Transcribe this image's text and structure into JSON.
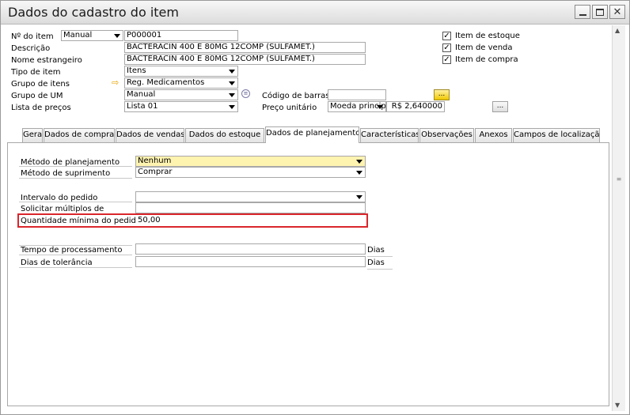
{
  "window": {
    "title": "Dados do cadastro do item"
  },
  "header": {
    "item_no_label": "Nº do item",
    "item_no_series": "Manual",
    "item_no_value": "P000001",
    "description_label": "Descrição",
    "description_value": "BACTERACIN 400 E 80MG 12COMP (SULFAMET.)",
    "foreign_name_label": "Nome estrangeiro",
    "foreign_name_value": "BACTERACIN 400 E 80MG 12COMP (SULFAMET.)",
    "item_type_label": "Tipo de item",
    "item_type_value": "Itens",
    "item_group_label": "Grupo de itens",
    "item_group_value": "Reg. Medicamentos",
    "uom_group_label": "Grupo de UM",
    "uom_group_value": "Manual",
    "price_list_label": "Lista de preços",
    "price_list_value": "Lista 01",
    "barcode_label": "Código de barras",
    "barcode_value": "",
    "unit_price_label": "Preço unitário",
    "currency_value": "Moeda princip",
    "unit_price_value": "R$ 2,640000",
    "ellipsis": "..."
  },
  "checkboxes": [
    {
      "label": "Item de estoque",
      "checked": true
    },
    {
      "label": "Item de venda",
      "checked": true
    },
    {
      "label": "Item de compra",
      "checked": true
    }
  ],
  "tabs": [
    {
      "label": "Geral"
    },
    {
      "label": "Dados de compra"
    },
    {
      "label": "Dados de vendas"
    },
    {
      "label": "Dados do estoque"
    },
    {
      "label": "Dados de planejamento"
    },
    {
      "label": "Características"
    },
    {
      "label": "Observações"
    },
    {
      "label": "Anexos"
    },
    {
      "label": "Campos de localização"
    }
  ],
  "planning": {
    "method_label": "Método de planejamento",
    "method_value": "Nenhum",
    "procurement_label": "Método de suprimento",
    "procurement_value": "Comprar",
    "order_interval_label": "Intervalo do pedido",
    "order_interval_value": "",
    "order_multiple_label": "Solicitar múltiplos de",
    "order_multiple_value": "",
    "min_order_label": "Quantidade mínima do pedido",
    "min_order_value": "50,00",
    "lead_time_label": "Tempo de processamento",
    "lead_time_value": "",
    "tolerance_label": "Dias de tolerância",
    "tolerance_value": "",
    "days_unit": "Dias"
  },
  "colors": {
    "highlight_border": "#d9262c",
    "mandatory_field": "#fff3b0"
  }
}
